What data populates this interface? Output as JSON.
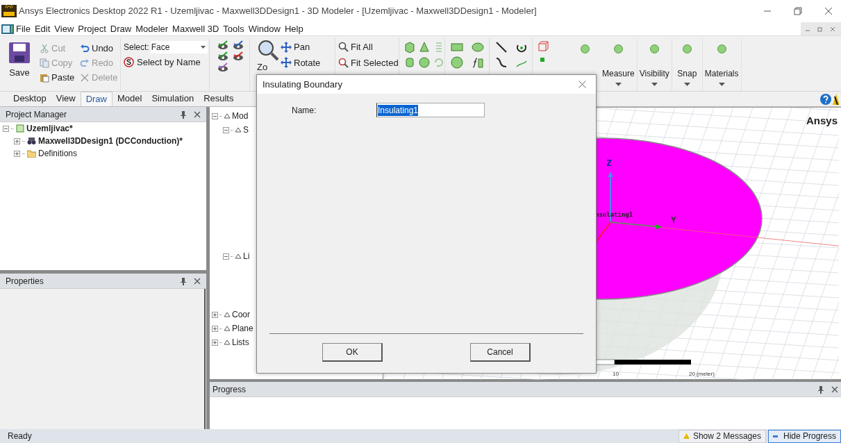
{
  "window": {
    "title": "Ansys Electronics Desktop 2022 R1 - Uzemljivac - Maxwell3DDesign1 - 3D Modeler - [Uzemljivac - Maxwell3DDesign1 - Modeler]"
  },
  "menu": [
    "File",
    "Edit",
    "View",
    "Project",
    "Draw",
    "Modeler",
    "Maxwell 3D",
    "Tools",
    "Window",
    "Help"
  ],
  "ribbon": {
    "save": "Save",
    "clipboard": [
      {
        "kind": "cut",
        "label": "Cut",
        "disabled": true
      },
      {
        "kind": "copy",
        "label": "Copy",
        "disabled": true
      },
      {
        "kind": "paste",
        "label": "Paste",
        "disabled": false
      }
    ],
    "history": [
      {
        "kind": "undo",
        "label": "Undo",
        "disabled": false
      },
      {
        "kind": "redo",
        "label": "Redo",
        "disabled": true
      },
      {
        "kind": "delete",
        "label": "Delete",
        "disabled": true
      }
    ],
    "select_label": "Select:",
    "select_value": "Face",
    "select_by_name": "Select by Name",
    "zoom": "Zo",
    "navigate": [
      "Pan",
      "Rotate"
    ],
    "fit": [
      "Fit All",
      "Fit Selected"
    ],
    "groups": [
      "Measure",
      "Visibility",
      "Snap",
      "Materials"
    ]
  },
  "tabs": [
    {
      "label": "Desktop",
      "selected": false
    },
    {
      "label": "View",
      "selected": false
    },
    {
      "label": "Draw",
      "selected": true
    },
    {
      "label": "Model",
      "selected": false
    },
    {
      "label": "Simulation",
      "selected": false
    },
    {
      "label": "Results",
      "selected": false
    }
  ],
  "project_manager": {
    "title": "Project Manager",
    "tree": [
      {
        "label": "Uzemljivac*",
        "active": true,
        "expanded": true,
        "children": [
          {
            "label": "Maxwell3DDesign1 (DCConduction)*",
            "active": true,
            "expanded": false
          },
          {
            "label": "Definitions",
            "active": false,
            "expanded": false
          }
        ]
      }
    ]
  },
  "properties": {
    "title": "Properties"
  },
  "model_tree": [
    {
      "label": "Mod",
      "expanded": true,
      "children": [
        {
          "label": "S",
          "expanded": true
        },
        {
          "label": "Li",
          "expanded": true
        }
      ]
    },
    {
      "label": "Coor",
      "expanded": false
    },
    {
      "label": "Plane",
      "expanded": false
    },
    {
      "label": "Lists",
      "expanded": false
    }
  ],
  "viewport": {
    "brand": "Ansys",
    "object_label": "nsulating1",
    "axis_z": "Z",
    "axis_y": "Y",
    "scale_labels": [
      "10",
      "20 (meter)"
    ]
  },
  "dialog": {
    "title": "Insulating Boundary",
    "name_label": "Name:",
    "name_value": "Insulating1",
    "buttons": [
      "OK",
      "Cancel"
    ]
  },
  "progress": {
    "title": "Progress"
  },
  "status_bar": {
    "text": "Ready",
    "buttons": [
      "Show 2 Messages",
      "Hide Progress"
    ]
  }
}
